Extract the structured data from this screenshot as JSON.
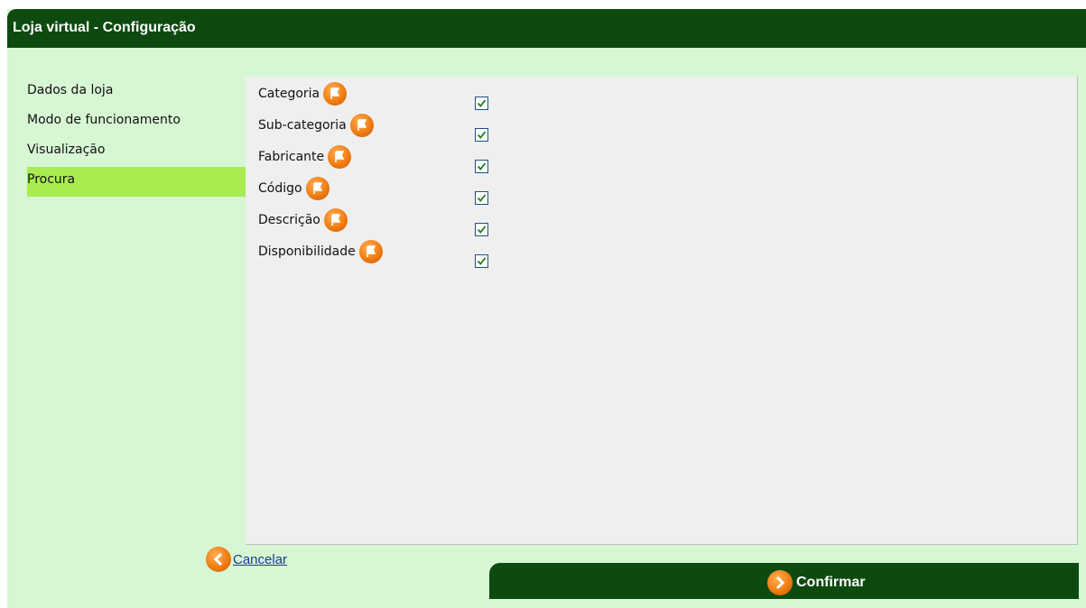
{
  "window": {
    "title": "Loja virtual - Configuração"
  },
  "sidebar": {
    "items": [
      {
        "label": "Dados da loja",
        "active": false
      },
      {
        "label": "Modo de funcionamento",
        "active": false
      },
      {
        "label": "Visualização",
        "active": false
      },
      {
        "label": "Procura",
        "active": true
      }
    ]
  },
  "search_fields": [
    {
      "label": "Categoria",
      "checked": true,
      "icon": "help-icon"
    },
    {
      "label": "Sub-categoria",
      "checked": true,
      "icon": "help-icon"
    },
    {
      "label": "Fabricante",
      "checked": true,
      "icon": "help-icon"
    },
    {
      "label": "Código",
      "checked": true,
      "icon": "help-icon"
    },
    {
      "label": "Descrição",
      "checked": true,
      "icon": "help-icon"
    },
    {
      "label": "Disponibilidade",
      "checked": true,
      "icon": "help-icon"
    }
  ],
  "footer": {
    "cancel_label": "Cancelar",
    "confirm_label": "Confirmar"
  },
  "colors": {
    "title_bar": "#0d4a10",
    "background": "#d7f6d3",
    "active_item": "#a8ec50",
    "panel": "#efefef",
    "icon_orange": "#f07c12"
  }
}
